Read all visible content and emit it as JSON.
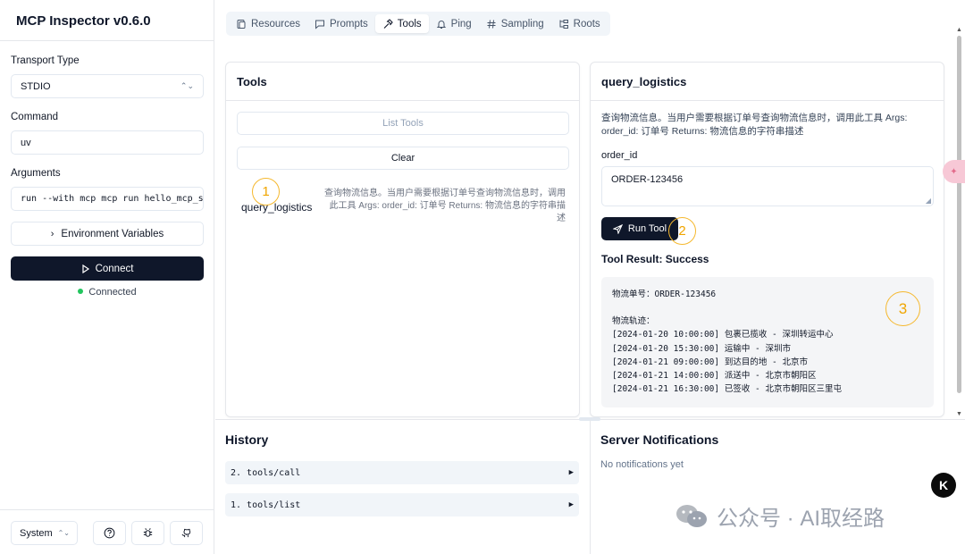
{
  "app": {
    "title": "MCP Inspector v0.6.0"
  },
  "sidebar": {
    "transport_label": "Transport Type",
    "transport_value": "STDIO",
    "command_label": "Command",
    "command_value": "uv",
    "arguments_label": "Arguments",
    "arguments_value": "run --with mcp mcp run hello_mcp_s",
    "env_button": "Environment Variables",
    "connect_button": "Connect",
    "status_text": "Connected",
    "status_color": "#22c55e",
    "theme_value": "System"
  },
  "tabs": [
    {
      "label": "Resources",
      "icon": "resources-icon"
    },
    {
      "label": "Prompts",
      "icon": "message-icon"
    },
    {
      "label": "Tools",
      "icon": "hammer-icon",
      "active": true
    },
    {
      "label": "Ping",
      "icon": "bell-icon"
    },
    {
      "label": "Sampling",
      "icon": "hash-icon"
    },
    {
      "label": "Roots",
      "icon": "folder-tree-icon"
    }
  ],
  "tools_panel": {
    "title": "Tools",
    "list_button": "List Tools",
    "clear_button": "Clear",
    "items": [
      {
        "name": "query_logistics",
        "description": "查询物流信息。当用户需要根据订单号查询物流信息时，调用此工具 Args: order_id: 订单号 Returns: 物流信息的字符串描述"
      }
    ]
  },
  "detail_panel": {
    "title": "query_logistics",
    "description": "查询物流信息。当用户需要根据订单号查询物流信息时，调用此工具 Args: order_id: 订单号 Returns: 物流信息的字符串描述",
    "param_label": "order_id",
    "param_value": "ORDER-123456",
    "run_button": "Run Tool",
    "result_title": "Tool Result: Success",
    "result_lines": [
      "物流单号：ORDER-123456",
      "",
      "物流轨迹：",
      "[2024-01-20 10:00:00] 包裹已揽收 - 深圳转运中心",
      "[2024-01-20 15:30:00] 运输中 - 深圳市",
      "[2024-01-21 09:00:00] 到达目的地 - 北京市",
      "[2024-01-21 14:00:00] 派送中 - 北京市朝阳区",
      "[2024-01-21 16:30:00] 已签收 - 北京市朝阳区三里屯"
    ]
  },
  "annotations": [
    "1",
    "2",
    "3"
  ],
  "history": {
    "title": "History",
    "items": [
      "2. tools/call",
      "1. tools/list"
    ]
  },
  "notifications": {
    "title": "Server Notifications",
    "empty_text": "No notifications yet"
  },
  "watermark": {
    "text": "公众号 · AI取经路"
  },
  "floating": {
    "k_label": "K"
  },
  "colors": {
    "primary": "#0f172a",
    "annotation": "#f5b82e",
    "connected": "#22c55e"
  }
}
